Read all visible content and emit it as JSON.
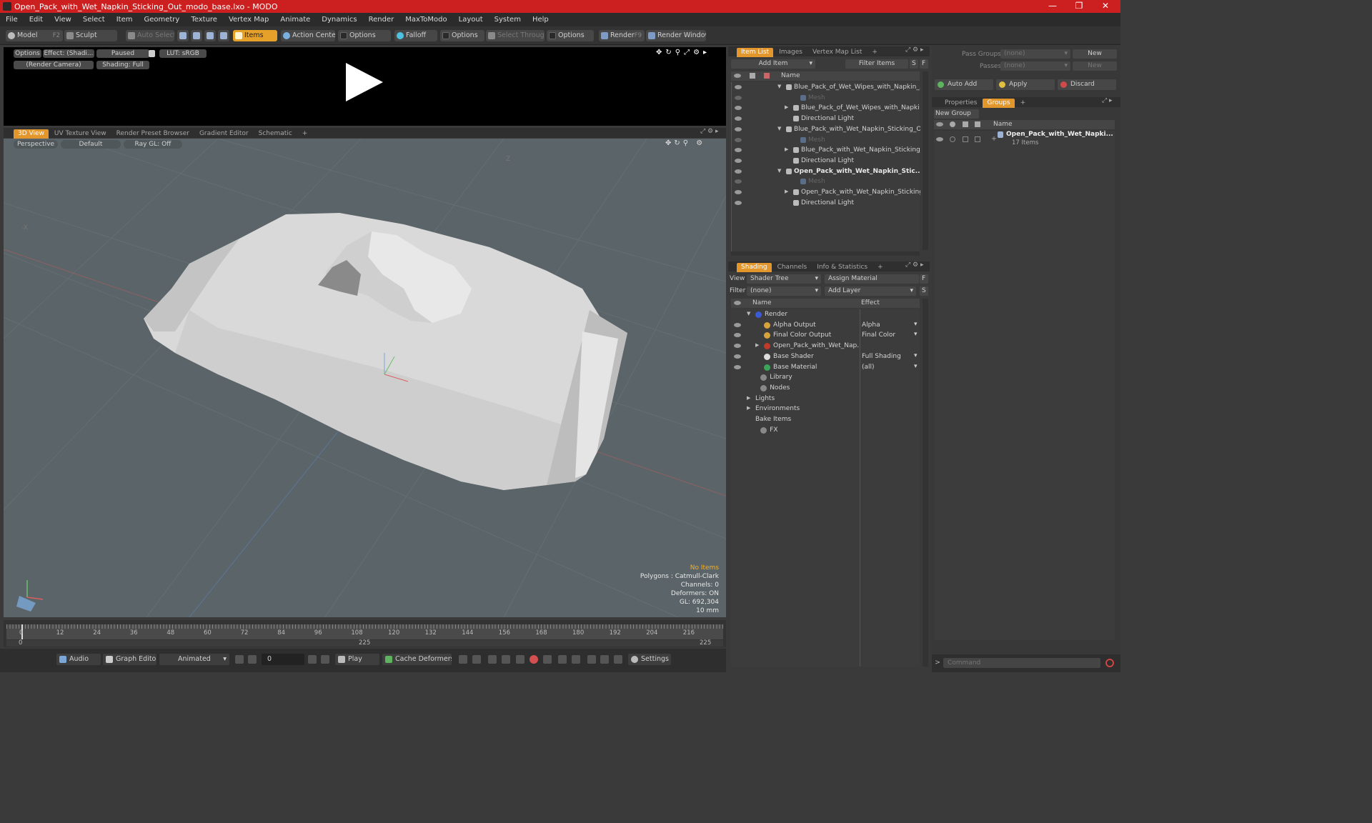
{
  "window": {
    "title": "Open_Pack_with_Wet_Napkin_Sticking_Out_modo_base.lxo - MODO",
    "min": "—",
    "max": "❐",
    "close": "✕"
  },
  "menu": [
    "File",
    "Edit",
    "View",
    "Select",
    "Item",
    "Geometry",
    "Texture",
    "Vertex Map",
    "Animate",
    "Dynamics",
    "Render",
    "MaxToModo",
    "Layout",
    "System",
    "Help"
  ],
  "toolbar": {
    "model": "Model",
    "model_key": "F2",
    "sculpt": "Sculpt",
    "auto_select": "Auto Select",
    "items": "Items",
    "action_center": "Action Center",
    "options1": "Options",
    "falloff": "Falloff",
    "options2": "Options",
    "select_through": "Select Through",
    "options3": "Options",
    "render": "Render",
    "render_key": "F9",
    "render_window": "Render Window"
  },
  "preview": {
    "options": "Options",
    "effect": "Effect: (Shadi...",
    "paused": "Paused",
    "lut": "LUT: sRGB",
    "camera": "(Render Camera)",
    "shading": "Shading: Full"
  },
  "viewport_tabs": [
    "3D View",
    "UV Texture View",
    "Render Preset Browser",
    "Gradient Editor",
    "Schematic"
  ],
  "viewport": {
    "perspective": "Perspective",
    "default": "Default",
    "raygl": "Ray GL: Off",
    "axis_z": "Z",
    "axis_x": "-X",
    "hud": {
      "no_items": "No Items",
      "polygons": "Polygons : Catmull-Clark",
      "channels": "Channels: 0",
      "deformers": "Deformers: ON",
      "gl": "GL: 692,304",
      "size": "10 mm"
    }
  },
  "timeline": {
    "ticks": [
      "0",
      "12",
      "24",
      "36",
      "48",
      "60",
      "72",
      "84",
      "96",
      "108",
      "120",
      "132",
      "144",
      "156",
      "168",
      "180",
      "192",
      "204",
      "216"
    ],
    "start": "0",
    "mid": "225",
    "end": "225"
  },
  "bottombar": {
    "audio": "Audio",
    "graph_editor": "Graph Editor",
    "animated": "Animated",
    "frame": "0",
    "play": "Play",
    "cache": "Cache Deformers",
    "settings": "Settings"
  },
  "item_list": {
    "tabs": [
      "Item List",
      "Images",
      "Vertex Map List"
    ],
    "add_item": "Add Item",
    "filter_items": "Filter Items",
    "s": "S",
    "f": "F",
    "header": "Name",
    "rows": [
      {
        "label": "Blue_Pack_of_Wet_Wipes_with_Napkin_...",
        "indent": 0,
        "dim": false,
        "bold": false,
        "exp": "open"
      },
      {
        "label": "Mesh",
        "indent": 2,
        "dim": true,
        "bold": false,
        "exp": ""
      },
      {
        "label": "Blue_Pack_of_Wet_Wipes_with_Napki ...",
        "indent": 1,
        "dim": false,
        "bold": false,
        "exp": "closed"
      },
      {
        "label": "Directional Light",
        "indent": 1,
        "dim": false,
        "bold": false,
        "exp": ""
      },
      {
        "label": "Blue_Pack_with_Wet_Napkin_Sticking_O ...",
        "indent": 0,
        "dim": false,
        "bold": false,
        "exp": "open"
      },
      {
        "label": "Mesh",
        "indent": 2,
        "dim": true,
        "bold": false,
        "exp": ""
      },
      {
        "label": "Blue_Pack_with_Wet_Napkin_Sticking_...",
        "indent": 1,
        "dim": false,
        "bold": false,
        "exp": "closed"
      },
      {
        "label": "Directional Light",
        "indent": 1,
        "dim": false,
        "bold": false,
        "exp": ""
      },
      {
        "label": "Open_Pack_with_Wet_Napkin_Stic...",
        "indent": 0,
        "dim": false,
        "bold": true,
        "exp": "open"
      },
      {
        "label": "Mesh",
        "indent": 2,
        "dim": true,
        "bold": false,
        "exp": ""
      },
      {
        "label": "Open_Pack_with_Wet_Napkin_Sticking...",
        "indent": 1,
        "dim": false,
        "bold": false,
        "exp": "closed"
      },
      {
        "label": "Directional Light",
        "indent": 1,
        "dim": false,
        "bold": false,
        "exp": ""
      }
    ]
  },
  "shading": {
    "tabs": [
      "Shading",
      "Channels",
      "Info & Statistics"
    ],
    "view_label": "View",
    "view_value": "Shader Tree",
    "assign_material": "Assign Material",
    "filter_label": "Filter",
    "filter_value": "(none)",
    "add_layer": "Add Layer",
    "f": "F",
    "s": "S",
    "col_name": "Name",
    "col_effect": "Effect",
    "rows": [
      {
        "label": "Render",
        "effect": "",
        "indent": 0,
        "eye": false,
        "exp": "open",
        "color": "#3b5bd6"
      },
      {
        "label": "Alpha Output",
        "effect": "Alpha",
        "indent": 1,
        "eye": true,
        "exp": "",
        "color": "#d8a23a"
      },
      {
        "label": "Final Color Output",
        "effect": "Final Color",
        "indent": 1,
        "eye": true,
        "exp": "",
        "color": "#d8a23a"
      },
      {
        "label": "Open_Pack_with_Wet_Nap...",
        "effect": "",
        "indent": 1,
        "eye": true,
        "exp": "closed",
        "color": "#c0392b"
      },
      {
        "label": "Base Shader",
        "effect": "Full Shading",
        "indent": 1,
        "eye": true,
        "exp": "",
        "color": "#dddddd"
      },
      {
        "label": "Base Material",
        "effect": "(all)",
        "indent": 1,
        "eye": true,
        "exp": "",
        "color": "#3aa657"
      },
      {
        "label": "Library",
        "effect": "",
        "indent": 0.6,
        "eye": false,
        "exp": "",
        "color": "#888"
      },
      {
        "label": "Nodes",
        "effect": "",
        "indent": 0.6,
        "eye": false,
        "exp": "",
        "color": "#888"
      },
      {
        "label": "Lights",
        "effect": "",
        "indent": 0,
        "eye": false,
        "exp": "closed",
        "color": ""
      },
      {
        "label": "Environments",
        "effect": "",
        "indent": 0,
        "eye": false,
        "exp": "closed",
        "color": ""
      },
      {
        "label": "Bake Items",
        "effect": "",
        "indent": 0,
        "eye": false,
        "exp": "",
        "color": ""
      },
      {
        "label": "FX",
        "effect": "",
        "indent": 0.6,
        "eye": false,
        "exp": "",
        "color": "#888"
      }
    ]
  },
  "right_panel": {
    "pass_groups": "Pass Groups",
    "passes": "Passes",
    "none1": "(none)",
    "none2": "(none)",
    "new1": "New",
    "new2": "New",
    "auto_add": "Auto Add",
    "apply": "Apply",
    "discard": "Discard",
    "tabs": [
      "Properties",
      "Groups"
    ],
    "new_group": "New Group",
    "header": "Name",
    "group_name": "Open_Pack_with_Wet_Napki...",
    "group_count": "17 Items"
  },
  "command": {
    "placeholder": "Command"
  },
  "colors": {
    "accent": "#e2962c",
    "titlebar": "#cc1f1f"
  }
}
